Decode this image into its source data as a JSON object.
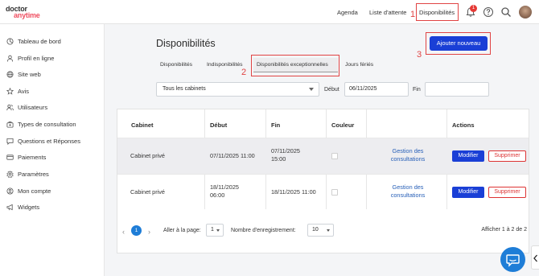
{
  "brand": {
    "logo_top": "doctor",
    "logo_bottom": "anytime"
  },
  "topnav": {
    "items": [
      {
        "label": "Agenda"
      },
      {
        "label": "Liste d'attente"
      },
      {
        "label": "Disponibilités"
      }
    ],
    "notification_count": "1"
  },
  "annotations": {
    "n1": "1",
    "n2": "2",
    "n3": "3"
  },
  "sidebar": {
    "items": [
      {
        "label": "Tableau de bord",
        "icon": "dashboard-icon"
      },
      {
        "label": "Profil en ligne",
        "icon": "user-icon"
      },
      {
        "label": "Site web",
        "icon": "globe-icon"
      },
      {
        "label": "Avis",
        "icon": "star-icon"
      },
      {
        "label": "Utilisateurs",
        "icon": "users-icon"
      },
      {
        "label": "Types de consultation",
        "icon": "medical-bag-icon"
      },
      {
        "label": "Questions et Réponses",
        "icon": "chat-icon"
      },
      {
        "label": "Paiements",
        "icon": "credit-card-icon"
      },
      {
        "label": "Paramètres",
        "icon": "gear-icon"
      },
      {
        "label": "Mon compte",
        "icon": "account-circle-icon"
      },
      {
        "label": "Widgets",
        "icon": "megaphone-icon"
      }
    ]
  },
  "main": {
    "title": "Disponibilités",
    "add_button": "Ajouter nouveau",
    "tabs": [
      {
        "label": "Disponibilités"
      },
      {
        "label": "Indisponibilités"
      },
      {
        "label": "Disponibilités exceptionnelles"
      },
      {
        "label": "Jours fériés"
      }
    ],
    "filters": {
      "cabinet_value": "Tous les cabinets",
      "debut_label": "Début",
      "debut_value": "06/11/2025",
      "fin_label": "Fin",
      "fin_value": ""
    },
    "table": {
      "headers": [
        "Cabinet",
        "Début",
        "Fin",
        "Couleur",
        "",
        "Actions"
      ],
      "rows": [
        {
          "cabinet": "Cabinet privé",
          "debut": "07/11/2025 11:00",
          "fin_line1": "07/11/2025",
          "fin_line2": "15:00",
          "link_line1": "Gestion des",
          "link_line2": "consultations",
          "edit": "Modifier",
          "delete": "Supprimer"
        },
        {
          "cabinet": "Cabinet privé",
          "debut_line1": "18/11/2025",
          "debut_line2": "06:00",
          "fin": "18/11/2025 11:00",
          "link_line1": "Gestion des",
          "link_line2": "consultations",
          "edit": "Modifier",
          "delete": "Supprimer"
        }
      ]
    },
    "pagination": {
      "current_page": "1",
      "goto_label": "Aller à la page:",
      "goto_value": "1",
      "per_page_label": "Nombre d'enregistrement:",
      "per_page_value": "10",
      "showing": "Afficher 1 à 2 de 2"
    }
  },
  "colors": {
    "primary": "#1a3fd6",
    "link": "#2860b8",
    "accent_red": "#e04444",
    "page_pill": "#1e7dd7"
  }
}
